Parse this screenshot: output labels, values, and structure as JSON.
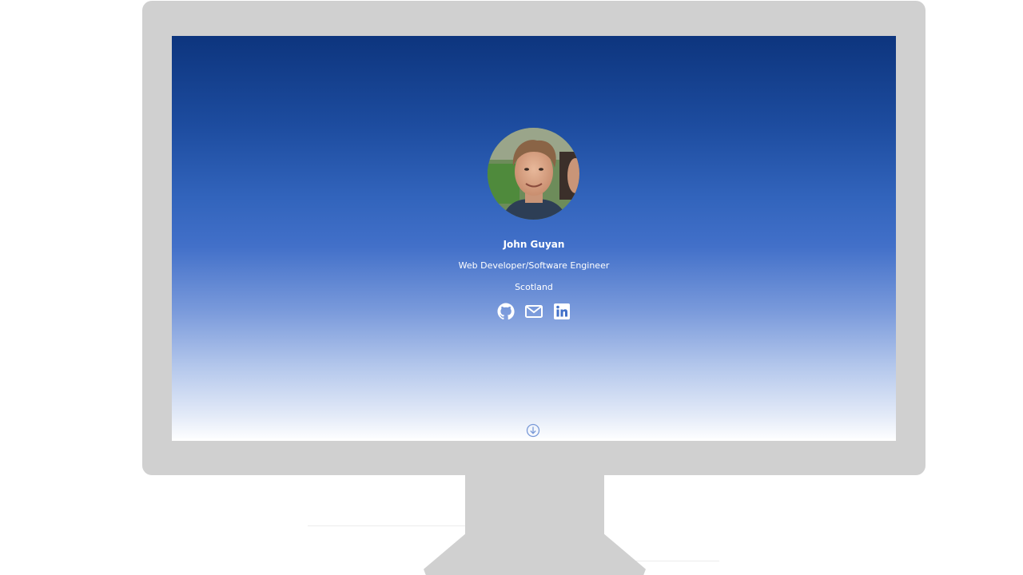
{
  "profile": {
    "name": "John Guyan",
    "role": "Web Developer/Software Engineer",
    "location": "Scotland",
    "avatar_icon": "profile-photo"
  },
  "social_links": [
    {
      "name": "github-icon"
    },
    {
      "name": "mail-icon"
    },
    {
      "name": "linkedin-icon"
    }
  ],
  "scroll_indicator": {
    "icon": "arrow-down-circle-icon"
  },
  "colors": {
    "gradient_top": "#0d357e",
    "gradient_mid": "#4270c9",
    "gradient_bottom": "#ffffff",
    "monitor_frame": "#d0d0d0",
    "text": "#ffffff"
  }
}
